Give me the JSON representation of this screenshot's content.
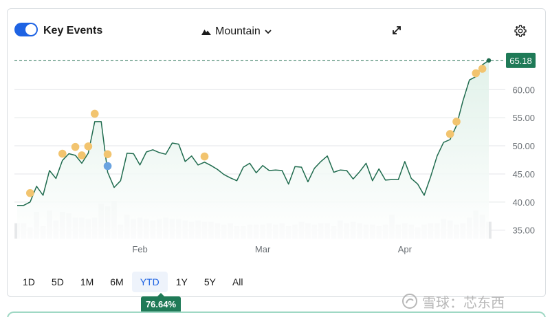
{
  "header": {
    "key_events_label": "Key Events",
    "key_events_on": true,
    "chart_type_label": "Mountain",
    "chart_type_icon": "mountain-icon",
    "expand_icon": "expand-icon",
    "settings_icon": "gear-icon"
  },
  "periods": [
    {
      "label": "1D",
      "active": false
    },
    {
      "label": "5D",
      "active": false
    },
    {
      "label": "1M",
      "active": false
    },
    {
      "label": "6M",
      "active": false
    },
    {
      "label": "YTD",
      "active": true
    },
    {
      "label": "1Y",
      "active": false
    },
    {
      "label": "5Y",
      "active": false
    },
    {
      "label": "All",
      "active": false
    }
  ],
  "return_badge": "76.64%",
  "watermark": {
    "text": "雪球：芯东西",
    "icon": "snowball-logo-icon"
  },
  "colors": {
    "line": "#1f6b4e",
    "area_top": "#dcefe6",
    "area_bottom": "#ffffff",
    "current_badge": "#1f7a57",
    "event_dot": "#f2c46f",
    "event_dot_blue": "#6aa3e0",
    "volume": "#e6e8ea",
    "grid": "#e3e6e8"
  },
  "chart_data": {
    "type": "area",
    "y_ticks": [
      35,
      40,
      45,
      50,
      55,
      60
    ],
    "y_tick_labels": [
      "35.00",
      "40.00",
      "45.00",
      "50.00",
      "55.00",
      "60.00"
    ],
    "ylim": [
      33.5,
      67.0
    ],
    "x_labels": [
      {
        "label": "Feb",
        "index": 19
      },
      {
        "label": "Mar",
        "index": 38
      },
      {
        "label": "Apr",
        "index": 60
      }
    ],
    "current_value": 65.18,
    "current_label": "65.18",
    "values": [
      39.4,
      39.4,
      40.0,
      42.8,
      41.2,
      45.6,
      44.2,
      47.4,
      48.6,
      48.3,
      46.9,
      48.7,
      54.3,
      54.3,
      45.3,
      42.6,
      43.8,
      48.7,
      48.6,
      46.6,
      48.9,
      49.3,
      48.8,
      48.5,
      50.5,
      50.3,
      47.2,
      48.2,
      46.6,
      47.1,
      46.5,
      45.8,
      44.9,
      44.3,
      43.8,
      46.2,
      46.9,
      45.2,
      46.5,
      45.6,
      45.7,
      45.6,
      43.2,
      46.3,
      46.2,
      43.6,
      46.0,
      47.2,
      48.2,
      45.3,
      45.7,
      45.6,
      44.1,
      45.4,
      46.9,
      43.8,
      45.9,
      43.9,
      44.0,
      44.0,
      47.2,
      44.2,
      43.2,
      41.2,
      44.5,
      48.2,
      50.6,
      51.1,
      53.6,
      58.0,
      61.7,
      62.3,
      64.4,
      65.18
    ],
    "volume": [
      11,
      11,
      8,
      19,
      9,
      20,
      13,
      19,
      18,
      15,
      15,
      14,
      15,
      25,
      23,
      27,
      10,
      17,
      14,
      15,
      14,
      13,
      14,
      15,
      14,
      14,
      13,
      12,
      13,
      12,
      12,
      11,
      10,
      11,
      9,
      9,
      10,
      10,
      10,
      11,
      10,
      11,
      9,
      10,
      12,
      11,
      10,
      11,
      11,
      9,
      13,
      11,
      12,
      11,
      10,
      10,
      9,
      10,
      17,
      10,
      11,
      10,
      8,
      10,
      11,
      11,
      14,
      13,
      10,
      11,
      15,
      20,
      17,
      12
    ],
    "events": [
      {
        "index": 2,
        "value": 41.6,
        "color": "orange"
      },
      {
        "index": 7,
        "value": 48.6,
        "color": "orange"
      },
      {
        "index": 9,
        "value": 49.8,
        "color": "orange"
      },
      {
        "index": 10,
        "value": 48.3,
        "color": "orange"
      },
      {
        "index": 11,
        "value": 49.9,
        "color": "orange"
      },
      {
        "index": 12,
        "value": 55.7,
        "color": "orange"
      },
      {
        "index": 14,
        "value": 48.5,
        "color": "orange"
      },
      {
        "index": 14,
        "value": 46.4,
        "color": "blue"
      },
      {
        "index": 29,
        "value": 48.1,
        "color": "orange"
      },
      {
        "index": 67,
        "value": 52.1,
        "color": "orange"
      },
      {
        "index": 68,
        "value": 54.3,
        "color": "orange"
      },
      {
        "index": 71,
        "value": 62.9,
        "color": "orange"
      },
      {
        "index": 72,
        "value": 63.7,
        "color": "orange"
      }
    ]
  }
}
